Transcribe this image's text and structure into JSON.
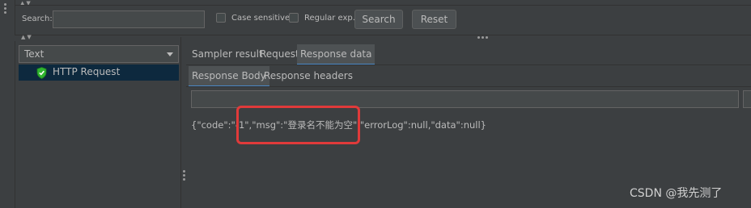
{
  "search": {
    "label": "Search:",
    "value": "",
    "case_sensitive_label": "Case sensitive",
    "regex_label": "Regular exp.",
    "search_button": "Search",
    "reset_button": "Reset"
  },
  "left_panel": {
    "renderer_selected": "Text",
    "tree_items": [
      {
        "label": "HTTP Request",
        "icon": "shield-check-icon",
        "status_color": "#2fb52f",
        "selected": true
      }
    ]
  },
  "result_tabs": {
    "tabs": [
      "Sampler result",
      "Request",
      "Response data"
    ],
    "selected": "Response data"
  },
  "response_subtabs": {
    "tabs": [
      "Response Body",
      "Response headers"
    ],
    "selected": "Response Body"
  },
  "response_body": {
    "text": "{\"code\":\"-1\",\"msg\":\"登录名不能为空\",\"errorLog\":null,\"data\":null}"
  },
  "annotation": {
    "highlight_color": "#e03a3a"
  },
  "watermark": {
    "text": "CSDN @我先测了"
  }
}
